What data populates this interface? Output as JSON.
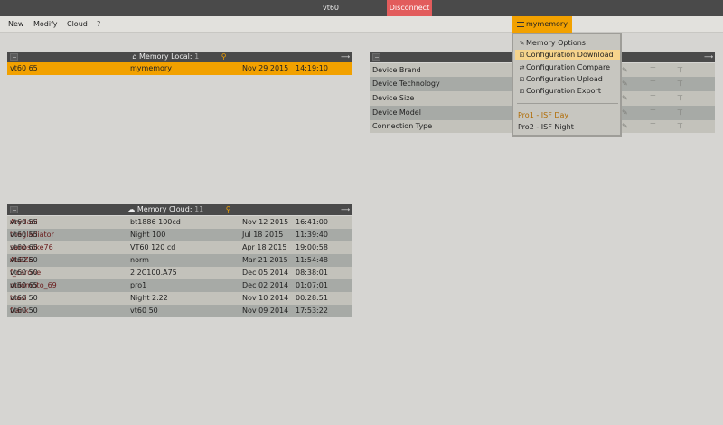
{
  "app": {
    "title": "vt60",
    "disconnect_label": "Disconnect"
  },
  "menubar": {
    "items": [
      "New",
      "Modify",
      "Cloud",
      "?"
    ],
    "memory_menu_label": "mymemory"
  },
  "local_panel": {
    "title": "Memory Local:",
    "count": "1",
    "rows": [
      {
        "device": "vt60 65",
        "name": "mymemory",
        "date": "Nov  29  2015",
        "time": "14:19:10"
      }
    ]
  },
  "cloud_panel": {
    "title": "Memory Cloud:",
    "count": "11",
    "rows": [
      {
        "device": "vt60 55",
        "user": "Arydani",
        "name": "bt1886 100cd",
        "date": "Nov  12  2015",
        "time": "16:41:00"
      },
      {
        "device": "vt60 55",
        "user": "thegladiator",
        "name": "Night 100",
        "date": "Jul   18  2015",
        "time": "11:39:40"
      },
      {
        "device": "vt60 65",
        "user": "sanosuke76",
        "name": "VT60 120 cd",
        "date": "Apr  18  2015",
        "time": "19:00:58"
      },
      {
        "device": "vt60 50",
        "user": "ALEZE",
        "name": "norm",
        "date": "Mar  21  2015",
        "time": "11:54:48"
      },
      {
        "device": "vt60 50",
        "user": "f_carone",
        "name": "2.2C100.A75",
        "date": "Dec  05  2014",
        "time": "08:38:01"
      },
      {
        "device": "vt60 65",
        "user": "mikimoto_69",
        "name": "pro1",
        "date": "Dec  02  2014",
        "time": "01:07:01"
      },
      {
        "device": "vt60 50",
        "user": "biasi",
        "name": "Night 2.22",
        "date": "Nov  10  2014",
        "time": "00:28:51"
      },
      {
        "device": "vt60 50",
        "user": "frank",
        "name": "vt60 50",
        "date": "Nov  09  2014",
        "time": "17:53:22"
      }
    ]
  },
  "info_panel": {
    "rows": [
      "Device Brand",
      "Device Technology",
      "Device Size",
      "Device Model",
      "Connection Type"
    ]
  },
  "dropdown": {
    "items": [
      "Memory Options",
      "Configuration Download",
      "Configuration Compare",
      "Configuration Upload",
      "Configuration Export"
    ],
    "presets": [
      "Pro1 - ISF Day",
      "Pro2 - ISF Night"
    ]
  },
  "colors": {
    "accent": "#f2a100",
    "disconnect": "#e25c5c",
    "header": "#4a4a4a",
    "user_text": "#6a1a1a"
  }
}
